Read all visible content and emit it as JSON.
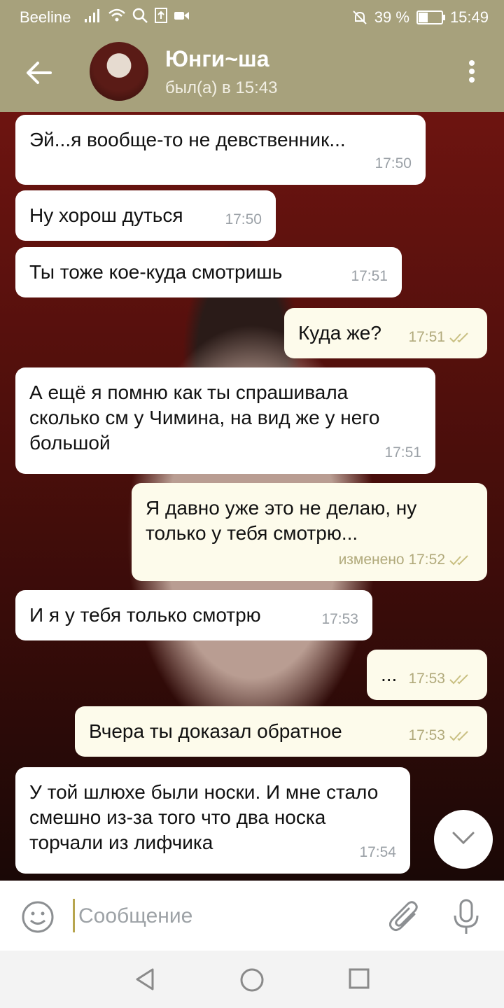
{
  "status_bar": {
    "carrier": "Beeline",
    "battery": "39 %",
    "time": "15:49",
    "icons": [
      "signal-icon",
      "wifi-icon",
      "search-icon",
      "upload-icon",
      "video-icon",
      "mute-icon",
      "battery-icon"
    ]
  },
  "header": {
    "title": "Юнги~ша",
    "subtitle": "был(а) в 15:43"
  },
  "messages": [
    {
      "dir": "in",
      "text": "Эй...я вообще-то не девственник...",
      "time": "17:50"
    },
    {
      "dir": "in",
      "text": "Ну хорош дуться",
      "time": "17:50"
    },
    {
      "dir": "in",
      "text": "Ты тоже кое-куда смотришь",
      "time": "17:51"
    },
    {
      "dir": "out",
      "text": "Куда же?",
      "time": "17:51"
    },
    {
      "dir": "in",
      "text": "А ещё я помню как ты спрашивала сколько см у Чимина, на вид же у него большой",
      "time": "17:51"
    },
    {
      "dir": "out",
      "text": "Я давно уже это не делаю, ну только у тебя смотрю...",
      "time": "изменено 17:52"
    },
    {
      "dir": "in",
      "text": "И я у тебя только смотрю",
      "time": "17:53"
    },
    {
      "dir": "out",
      "text": "...",
      "time": "17:53"
    },
    {
      "dir": "out",
      "text": "Вчера ты доказал обратное",
      "time": "17:53"
    },
    {
      "dir": "in",
      "text": "У той шлюхе были носки. И мне стало смешно из-за того что два носка торчали из лифчика",
      "time": "17:54"
    }
  ],
  "composer": {
    "placeholder": "Сообщение"
  }
}
